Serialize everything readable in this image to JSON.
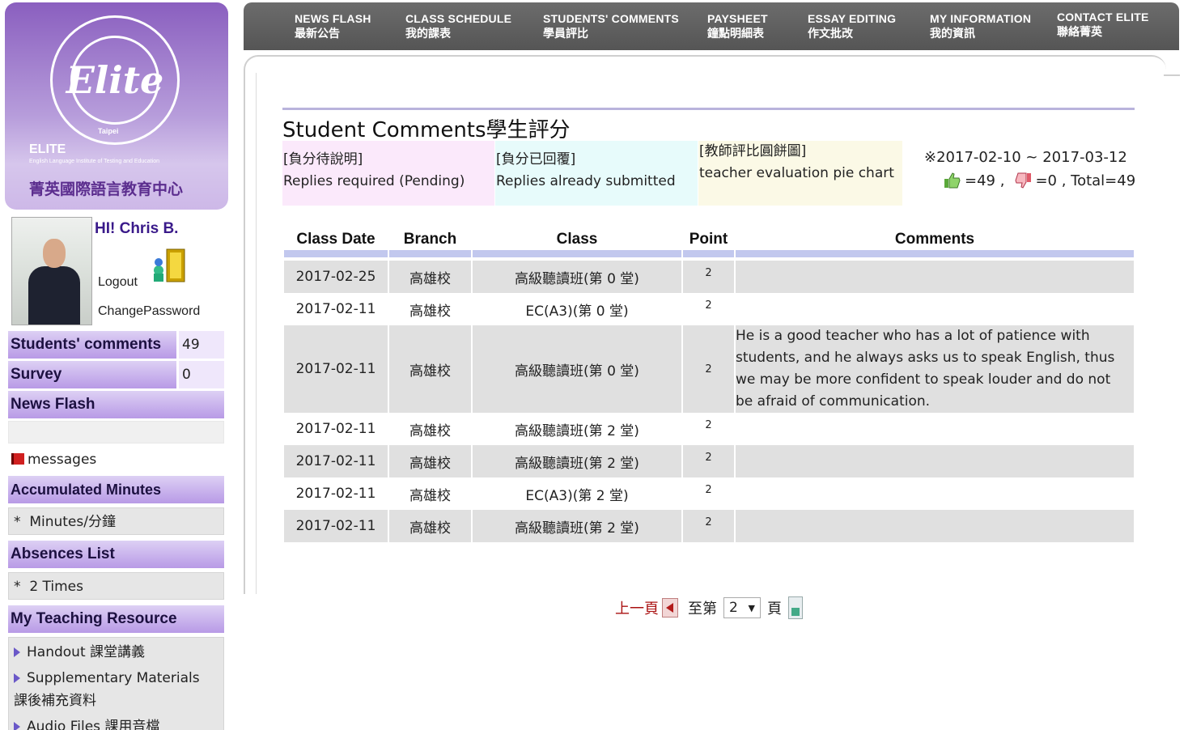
{
  "logo": {
    "script": "Elite",
    "ring_text": "English Language Institute of Testing and Education",
    "city": "Taipei",
    "brand": "ELITE",
    "subtitle": "English Language Institute of Testing and Education",
    "chinese_name": "菁英國際語言教育中心"
  },
  "user": {
    "greeting": "HI! Chris B.",
    "logout": "Logout",
    "change_password": "ChangePassword"
  },
  "sidebar": {
    "students_comments": {
      "label": "Students' comments",
      "count": "49"
    },
    "survey": {
      "label": "Survey",
      "count": "0"
    },
    "news_flash": "News Flash",
    "messages": "messages",
    "accumulated_minutes": "Accumulated Minutes",
    "minutes_item": "Minutes/分鐘",
    "absences_list": "Absences List",
    "absences_item": "2 Times",
    "teaching_resource": "My Teaching Resource",
    "resources": [
      "Handout 課堂講義",
      "Supplementary Materials",
      "課後補充資料",
      "Audio Files 課用音檔"
    ]
  },
  "nav": [
    {
      "en": "NEWS FLASH",
      "cn": "最新公告"
    },
    {
      "en": "CLASS SCHEDULE",
      "cn": "我的課表"
    },
    {
      "en": "STUDENTS' COMMENTS",
      "cn": "學員評比"
    },
    {
      "en": "PAYSHEET",
      "cn": "鐘點明細表"
    },
    {
      "en": "ESSAY EDITING",
      "cn": "作文批改"
    },
    {
      "en": "MY INFORMATION",
      "cn": "我的資訊"
    },
    {
      "en": "CONTACT ELITE",
      "cn": "聯絡菁英"
    }
  ],
  "page": {
    "title": "Student Comments學生評分",
    "legend": {
      "pending_tag": "[負分待說明]",
      "pending_text": "Replies required (Pending)",
      "submitted_tag": "[負分已回覆]",
      "submitted_text": "Replies already submitted",
      "pie_tag": "[教師評比圓餅圖]",
      "pie_text": "teacher evaluation pie chart"
    },
    "date_range": "※2017-02-10 ~ 2017-03-12",
    "positive_count": "=49 ,",
    "negative_count": "=0 , Total=49"
  },
  "table": {
    "headers": [
      "Class Date",
      "Branch",
      "Class",
      "Point",
      "Comments"
    ],
    "rows": [
      {
        "date": "2017-02-25",
        "branch": "高雄校",
        "class": "高級聽讀班(第 0 堂)",
        "point": "2",
        "comment": ""
      },
      {
        "date": "2017-02-11",
        "branch": "高雄校",
        "class": "EC(A3)(第 0 堂)",
        "point": "2",
        "comment": ""
      },
      {
        "date": "2017-02-11",
        "branch": "高雄校",
        "class": "高級聽讀班(第 0 堂)",
        "point": "2",
        "comment": "He is a good teacher who has a lot of patience with students, and he always asks us to speak English, thus we may be more confident to speak louder and do not be afraid of communication."
      },
      {
        "date": "2017-02-11",
        "branch": "高雄校",
        "class": "高級聽讀班(第 2 堂)",
        "point": "2",
        "comment": ""
      },
      {
        "date": "2017-02-11",
        "branch": "高雄校",
        "class": "高級聽讀班(第 2 堂)",
        "point": "2",
        "comment": ""
      },
      {
        "date": "2017-02-11",
        "branch": "高雄校",
        "class": "EC(A3)(第 2 堂)",
        "point": "2",
        "comment": ""
      },
      {
        "date": "2017-02-11",
        "branch": "高雄校",
        "class": "高級聽讀班(第 2 堂)",
        "point": "2",
        "comment": ""
      }
    ]
  },
  "pager": {
    "prev": "上一頁",
    "goto": "至第",
    "page_value": "2",
    "page_suffix": "頁"
  },
  "colors": {
    "nav_bg": "#5f5f5f",
    "sidebar_header": "#b89ae6",
    "row_gray": "#e0e0e0",
    "header_rule": "#c2c8ee"
  }
}
